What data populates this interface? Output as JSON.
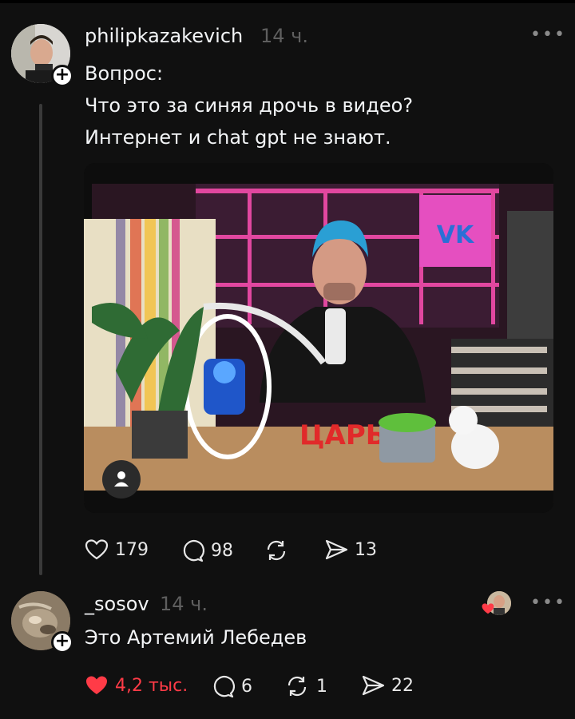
{
  "post1": {
    "username": "philipkazakevich",
    "time": "14 ч.",
    "lines": [
      "Вопрос:",
      "Что это за синяя дрочь в видео?",
      "Интернет и chat gpt не знают."
    ],
    "likes": "179",
    "comments": "98",
    "shares": "13",
    "media": {
      "sign_text": "ЦАРЬ",
      "logo_text": "VK"
    }
  },
  "post2": {
    "username": "_sosov",
    "time": "14 ч.",
    "text": "Это Артемий Лебедев",
    "likes": "4,2 тыс.",
    "comments": "6",
    "reposts": "1",
    "shares": "22"
  },
  "colors": {
    "background": "#101010",
    "text": "#f3f5f7",
    "muted": "#5f5f5f",
    "liked": "#ff3b47"
  },
  "icons": [
    "heart-icon",
    "comment-icon",
    "repost-icon",
    "send-icon",
    "more-icon",
    "follow-plus-icon",
    "person-icon"
  ]
}
